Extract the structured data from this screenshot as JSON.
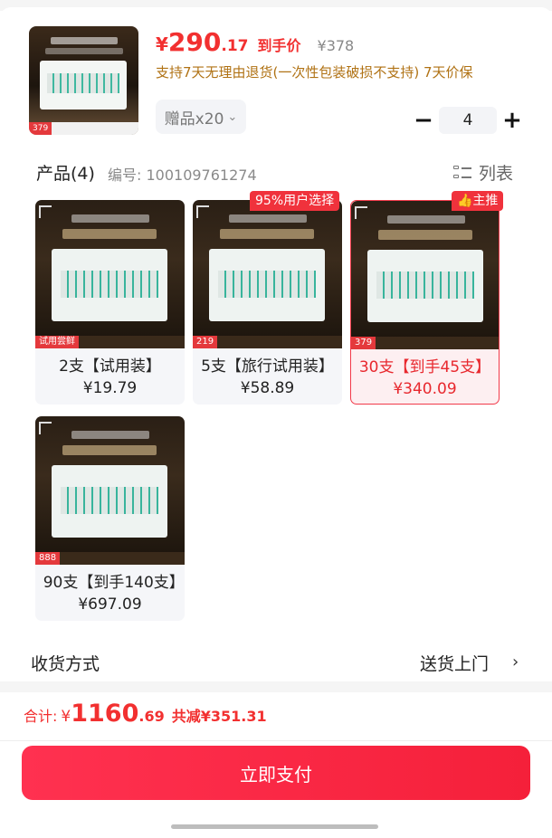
{
  "header": {
    "price_currency": "¥",
    "price_integer": "290",
    "price_decimal": ".17",
    "price_label": "到手价",
    "original_price": "¥378",
    "policy": "支持7天无理由退货(一次性包装破损不支持) 7天价保",
    "thumb_tag": "379",
    "gift": "赠品x20",
    "gift_arrow": "⌄",
    "quantity": "4",
    "minus": "−",
    "plus": "+"
  },
  "products": {
    "title": "产品(4)",
    "code_label": "编号: 100109761274",
    "list_toggle_label": "列表",
    "items": [
      {
        "name": "2支【试用装】¥19.79",
        "img_tag": "试用尝鲜",
        "badge": ""
      },
      {
        "name": "5支【旅行试用装】¥58.89",
        "img_tag": "219",
        "badge": "95%用户选择"
      },
      {
        "name": "30支【到手45支】¥340.09",
        "img_tag": "379",
        "badge": "👍主推"
      },
      {
        "name": "90支【到手140支】¥697.09",
        "img_tag": "888",
        "badge": ""
      }
    ]
  },
  "delivery": {
    "label": "收货方式",
    "value": "送货上门",
    "arrow": "›"
  },
  "total": {
    "label": "合计:",
    "currency": "¥",
    "integer": "1160",
    "decimal": ".69",
    "saving": "共减¥351.31"
  },
  "pay_button": "立即支付",
  "colors": {
    "accent": "#f23030",
    "policy_text": "#b07214",
    "selected_border": "#f23a4a"
  }
}
